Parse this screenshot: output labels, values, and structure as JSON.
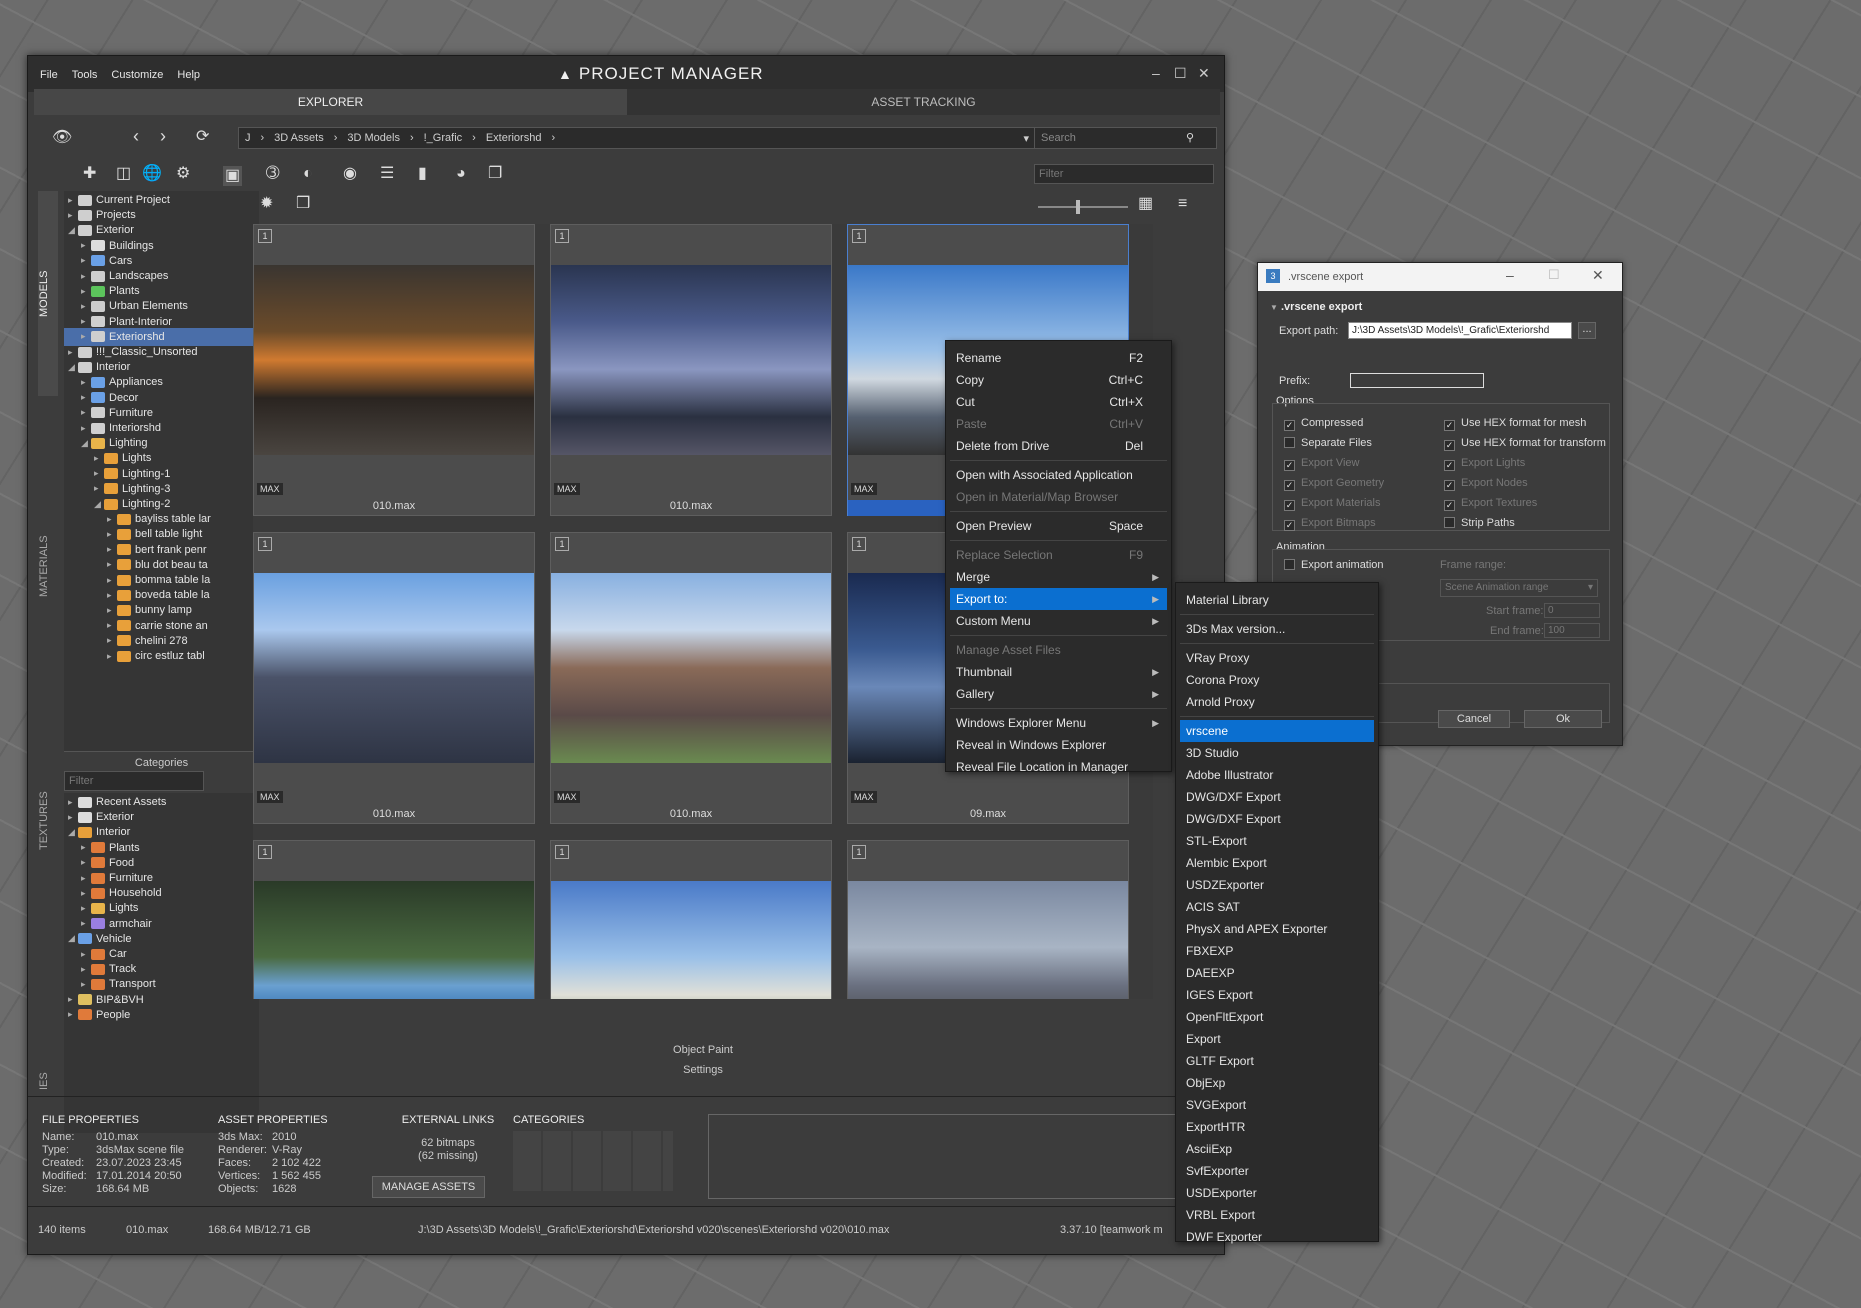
{
  "app": {
    "menu": [
      "File",
      "Tools",
      "Customize",
      "Help"
    ],
    "title": "PROJECT MANAGER",
    "tabs": [
      "EXPLORER",
      "ASSET TRACKING"
    ]
  },
  "toolbar": {
    "path": [
      "J",
      "3D Assets",
      "3D Models",
      "!_Grafic",
      "Exteriorshd"
    ],
    "search_placeholder": "Search",
    "filter_placeholder": "Filter"
  },
  "side_tabs": [
    "MODELS",
    "MATERIALS",
    "TEXTURES",
    "IES"
  ],
  "tree": [
    {
      "label": "Current Project",
      "indent": 0,
      "icon": "drive-icon"
    },
    {
      "label": "Projects",
      "indent": 0,
      "icon": "drive-icon"
    },
    {
      "label": "Exterior",
      "indent": 0,
      "icon": "drive-icon",
      "open": true
    },
    {
      "label": "Buildings",
      "indent": 1,
      "icon": "house-icon"
    },
    {
      "label": "Cars",
      "indent": 1,
      "icon": "car-icon"
    },
    {
      "label": "Landscapes",
      "indent": 1,
      "icon": "drive-icon"
    },
    {
      "label": "Plants",
      "indent": 1,
      "icon": "plant-icon"
    },
    {
      "label": "Urban Elements",
      "indent": 1,
      "icon": "building-icon"
    },
    {
      "label": "Plant-Interior",
      "indent": 1,
      "icon": "drive-icon"
    },
    {
      "label": "Exteriorshd",
      "indent": 1,
      "icon": "drive-icon",
      "selected": true
    },
    {
      "label": "!!!_Classic_Unsorted",
      "indent": 0,
      "icon": "drive-icon"
    },
    {
      "label": "Interior",
      "indent": 0,
      "icon": "drive-icon",
      "open": true
    },
    {
      "label": "Appliances",
      "indent": 1,
      "icon": "appliance-icon"
    },
    {
      "label": "Decor",
      "indent": 1,
      "icon": "decor-icon"
    },
    {
      "label": "Furniture",
      "indent": 1,
      "icon": "drive-icon"
    },
    {
      "label": "Interiorshd",
      "indent": 1,
      "icon": "drive-icon"
    },
    {
      "label": "Lighting",
      "indent": 1,
      "icon": "bulb-icon",
      "open": true
    },
    {
      "label": "Lights",
      "indent": 2,
      "icon": "folder-icon"
    },
    {
      "label": "Lighting-1",
      "indent": 2,
      "icon": "folder-icon"
    },
    {
      "label": "Lighting-3",
      "indent": 2,
      "icon": "folder-icon"
    },
    {
      "label": "Lighting-2",
      "indent": 2,
      "icon": "folder-icon",
      "open": true
    },
    {
      "label": "bayliss table lar",
      "indent": 3,
      "icon": "folder-icon"
    },
    {
      "label": "bell table light",
      "indent": 3,
      "icon": "folder-icon"
    },
    {
      "label": "bert frank penr",
      "indent": 3,
      "icon": "folder-icon"
    },
    {
      "label": "blu dot beau ta",
      "indent": 3,
      "icon": "folder-icon"
    },
    {
      "label": "bomma table la",
      "indent": 3,
      "icon": "folder-icon"
    },
    {
      "label": "boveda table la",
      "indent": 3,
      "icon": "folder-icon"
    },
    {
      "label": "bunny lamp",
      "indent": 3,
      "icon": "folder-icon"
    },
    {
      "label": "carrie stone an",
      "indent": 3,
      "icon": "folder-icon"
    },
    {
      "label": "chelini 278",
      "indent": 3,
      "icon": "folder-icon"
    },
    {
      "label": "circ estluz tabl",
      "indent": 3,
      "icon": "folder-icon"
    }
  ],
  "categories": {
    "title": "Categories",
    "filter_placeholder": "Filter",
    "items": [
      {
        "label": "Recent Assets",
        "indent": 0,
        "icon": "history-icon"
      },
      {
        "label": "Exterior",
        "indent": 0,
        "icon": "house-icon"
      },
      {
        "label": "Interior",
        "indent": 0,
        "icon": "interior-icon",
        "open": true
      },
      {
        "label": "Plants",
        "indent": 1,
        "icon": "tag-icon"
      },
      {
        "label": "Food",
        "indent": 1,
        "icon": "tag-icon"
      },
      {
        "label": "Furniture",
        "indent": 1,
        "icon": "tag-icon"
      },
      {
        "label": "Household",
        "indent": 1,
        "icon": "tag-icon"
      },
      {
        "label": "Lights",
        "indent": 1,
        "icon": "bulb-icon"
      },
      {
        "label": "armchair",
        "indent": 1,
        "icon": "armchair-icon"
      },
      {
        "label": "Vehicle",
        "indent": 0,
        "icon": "car-icon",
        "open": true
      },
      {
        "label": "Car",
        "indent": 1,
        "icon": "tag-icon"
      },
      {
        "label": "Track",
        "indent": 1,
        "icon": "tag-icon"
      },
      {
        "label": "Transport",
        "indent": 1,
        "icon": "tag-icon"
      },
      {
        "label": "BIP&BVH",
        "indent": 0,
        "icon": "biped-icon"
      },
      {
        "label": "People",
        "indent": 0,
        "icon": "tag-icon"
      }
    ]
  },
  "assets": [
    {
      "num": "1",
      "badge": "MAX",
      "name": "010.max",
      "scene": "modern-house-car"
    },
    {
      "num": "1",
      "badge": "MAX",
      "name": "010.max",
      "scene": "blue-building"
    },
    {
      "num": "1",
      "badge": "MAX",
      "name": "",
      "scene": "city-sky",
      "selected": true
    },
    {
      "num": "1",
      "badge": "MAX",
      "name": "010.max",
      "scene": "skyscraper"
    },
    {
      "num": "1",
      "badge": "MAX",
      "name": "010.max",
      "scene": "round-building"
    },
    {
      "num": "1",
      "badge": "MAX",
      "name": "09.max",
      "scene": "night-building"
    },
    {
      "num": "1",
      "badge": "",
      "name": "",
      "scene": "palm-sea"
    },
    {
      "num": "1",
      "badge": "",
      "name": "",
      "scene": "museum"
    },
    {
      "num": "1",
      "badge": "",
      "name": "",
      "scene": "bridge-car"
    }
  ],
  "bottom_links": [
    "Object Paint",
    "Settings"
  ],
  "context_menu": [
    {
      "label": "Rename",
      "shortcut": "F2"
    },
    {
      "label": "Copy",
      "shortcut": "Ctrl+C"
    },
    {
      "label": "Cut",
      "shortcut": "Ctrl+X"
    },
    {
      "label": "Paste",
      "shortcut": "Ctrl+V",
      "disabled": true
    },
    {
      "label": "Delete from Drive",
      "shortcut": "Del",
      "sep_after": true
    },
    {
      "label": "Open with Associated Application"
    },
    {
      "label": "Open in Material/Map Browser",
      "disabled": true,
      "sep_after": true
    },
    {
      "label": "Open Preview",
      "shortcut": "Space",
      "sep_after": true
    },
    {
      "label": "Replace Selection",
      "shortcut": "F9",
      "disabled": true
    },
    {
      "label": "Merge",
      "submenu": true
    },
    {
      "label": "Export to:",
      "submenu": true,
      "highlighted": true
    },
    {
      "label": "Custom Menu",
      "submenu": true,
      "sep_after": true
    },
    {
      "label": "Manage Asset Files",
      "disabled": true
    },
    {
      "label": "Thumbnail",
      "submenu": true
    },
    {
      "label": "Gallery",
      "submenu": true,
      "sep_after": true
    },
    {
      "label": "Windows Explorer Menu",
      "submenu": true
    },
    {
      "label": "Reveal in Windows Explorer"
    },
    {
      "label": "Reveal File Location in Manager"
    }
  ],
  "export_menu": [
    {
      "label": "Material Library",
      "sep_after": true
    },
    {
      "label": "3Ds Max version...",
      "sep_after": true
    },
    {
      "label": "VRay Proxy"
    },
    {
      "label": "Corona Proxy"
    },
    {
      "label": "Arnold Proxy",
      "sep_after": true
    },
    {
      "label": "vrscene",
      "highlighted": true
    },
    {
      "label": "3D Studio"
    },
    {
      "label": "Adobe Illustrator"
    },
    {
      "label": "DWG/DXF Export"
    },
    {
      "label": "DWG/DXF Export"
    },
    {
      "label": "STL-Export"
    },
    {
      "label": "Alembic Export"
    },
    {
      "label": "USDZExporter"
    },
    {
      "label": "ACIS SAT"
    },
    {
      "label": "PhysX and APEX Exporter"
    },
    {
      "label": "FBXEXP"
    },
    {
      "label": "DAEEXP"
    },
    {
      "label": "IGES Export"
    },
    {
      "label": "OpenFltExport"
    },
    {
      "label": "Export"
    },
    {
      "label": "GLTF Export"
    },
    {
      "label": "ObjExp"
    },
    {
      "label": "SVGExport"
    },
    {
      "label": "ExportHTR"
    },
    {
      "label": "AsciiExp"
    },
    {
      "label": "SvfExporter"
    },
    {
      "label": "USDExporter"
    },
    {
      "label": "VRBL Export"
    },
    {
      "label": "DWF Exporter"
    }
  ],
  "dialog": {
    "title": ".vrscene export",
    "section": ".vrscene export",
    "export_path_label": "Export path:",
    "export_path_value": "J:\\3D Assets\\3D Models\\!_Grafic\\Exteriorshd",
    "browse_label": "...",
    "prefix_label": "Prefix:",
    "options_label": "Options",
    "options_left": [
      {
        "label": "Compressed",
        "checked": true,
        "disabled": false
      },
      {
        "label": "Separate Files",
        "checked": false,
        "disabled": false
      },
      {
        "label": "Export View",
        "checked": true,
        "disabled": true
      },
      {
        "label": "Export Geometry",
        "checked": true,
        "disabled": true
      },
      {
        "label": "Export Materials",
        "checked": true,
        "disabled": true
      },
      {
        "label": "Export Bitmaps",
        "checked": true,
        "disabled": true
      }
    ],
    "options_right": [
      {
        "label": "Use HEX format for mesh",
        "checked": true,
        "disabled": false
      },
      {
        "label": "Use HEX format for transform",
        "checked": true,
        "disabled": false
      },
      {
        "label": "Export Lights",
        "checked": true,
        "disabled": true
      },
      {
        "label": "Export Nodes",
        "checked": true,
        "disabled": true
      },
      {
        "label": "Export Textures",
        "checked": true,
        "disabled": true
      },
      {
        "label": "Strip Paths",
        "checked": false,
        "disabled": false
      }
    ],
    "animation_label": "Animation",
    "export_animation_label": "Export animation",
    "frame_range_label": "Frame range:",
    "frame_range_value": "Scene Animation range",
    "start_frame_label": "Start frame:",
    "start_frame_value": "0",
    "end_frame_label": "End frame:",
    "end_frame_value": "100",
    "cancel_label": "Cancel",
    "ok_label": "Ok"
  },
  "properties": {
    "file": {
      "title": "FILE PROPERTIES",
      "rows": [
        [
          "Name:",
          "010.max"
        ],
        [
          "Type:",
          "3dsMax scene file"
        ],
        [
          "Created:",
          "23.07.2023 23:45"
        ],
        [
          "Modified:",
          "17.01.2014 20:50"
        ],
        [
          "Size:",
          "168.64 MB"
        ]
      ]
    },
    "asset": {
      "title": "ASSET PROPERTIES",
      "rows": [
        [
          "3ds Max:",
          "2010"
        ],
        [
          "Renderer:",
          "V-Ray"
        ],
        [
          "Faces:",
          "2 102 422"
        ],
        [
          "Vertices:",
          "1 562 455"
        ],
        [
          "Objects:",
          "1628"
        ]
      ]
    },
    "links": {
      "title": "EXTERNAL LINKS",
      "bitmaps": "62 bitmaps",
      "missing": "(62 missing)",
      "button": "MANAGE ASSETS"
    },
    "categories_title": "CATEGORIES"
  },
  "status": {
    "items": "140 items",
    "file": "010.max",
    "size": "168.64 MB/12.71 GB",
    "path": "J:\\3D Assets\\3D Models\\!_Grafic\\Exteriorshd\\Exteriorshd v020\\scenes\\Exteriorshd v020\\010.max",
    "version": "3.37.10 [teamwork m"
  }
}
